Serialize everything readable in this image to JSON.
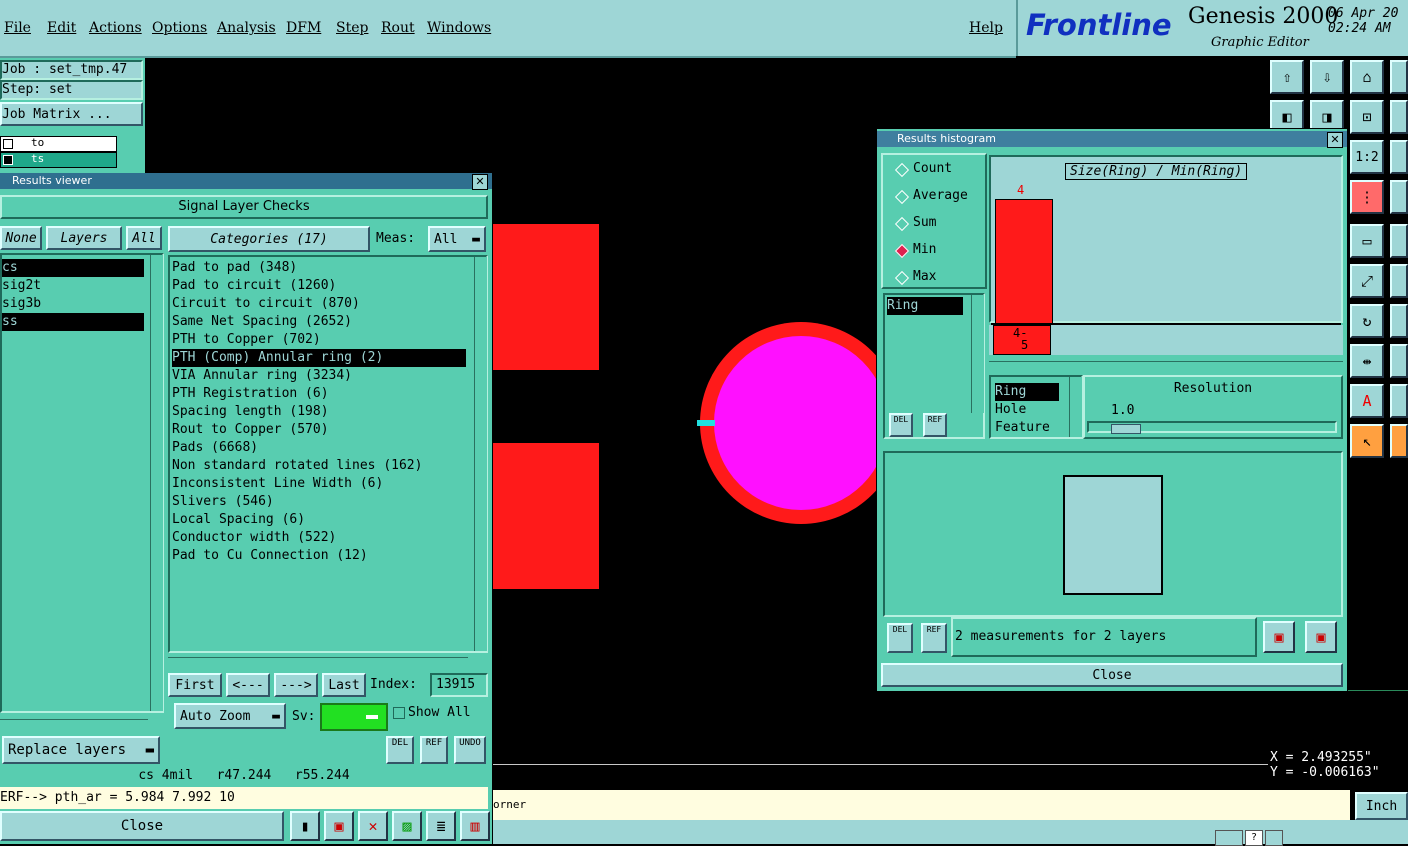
{
  "menu": {
    "file": "File",
    "edit": "Edit",
    "actions": "Actions",
    "options": "Options",
    "analysis": "Analysis",
    "dfm": "DFM",
    "step": "Step",
    "rout": "Rout",
    "windows": "Windows",
    "help": "Help"
  },
  "brand": {
    "logo": "Frontline",
    "title": "Genesis 2000",
    "subtitle": "Graphic Editor",
    "date": "06 Apr 20",
    "time": "02:24 AM"
  },
  "job": {
    "job": "Job : set_tmp.47",
    "step": "Step: set",
    "matrix": "Job Matrix ..."
  },
  "layers_small": [
    "to",
    "ts"
  ],
  "results_viewer": {
    "title": "Results viewer",
    "header": "Signal Layer Checks",
    "none": "None",
    "layers": "Layers",
    "all": "All",
    "categories_label": "Categories (17)",
    "meas_label": "Meas:",
    "meas_value": "All",
    "layer_list": [
      "cs",
      "sig2t",
      "sig3b",
      "ss"
    ],
    "categories": [
      "Pad to pad (348)",
      "Pad to circuit (1260)",
      "Circuit to circuit (870)",
      "Same Net Spacing (2652)",
      "PTH to Copper (702)",
      "PTH (Comp) Annular ring (2)",
      "VIA Annular ring (3234)",
      "PTH Registration (6)",
      "Spacing length (198)",
      "Rout to Copper (570)",
      "Pads (6668)",
      "Non standard rotated lines (162)",
      "Inconsistent Line Width (6)",
      "Slivers (546)",
      "Local Spacing (6)",
      "Conductor width (522)",
      "Pad to Cu Connection (12)"
    ],
    "first": "First",
    "prev": "<---",
    "next": "--->",
    "last": "Last",
    "index_label": "Index:",
    "index_value": "13915",
    "auto_zoom": "Auto Zoom",
    "sv": "Sv:",
    "show_all": "Show All",
    "replace_layers": "Replace layers",
    "del": "DEL",
    "ref": "REF",
    "undo": "UNDO",
    "status": "cs 4mil   r47.244   r55.244",
    "erf": "ERF--> pth_ar = 5.984 7.992 10",
    "close": "Close"
  },
  "histogram": {
    "title": "Results histogram",
    "options": [
      "Count",
      "Average",
      "Sum",
      "Min",
      "Max"
    ],
    "selected_option": "Min",
    "chart_title": "Size(Ring) / Min(Ring)",
    "bar_label": "4",
    "range_label_top": "4-",
    "range_label_bottom": "5",
    "attr_list": [
      "Ring"
    ],
    "attr_list2": [
      "Ring",
      "Hole",
      "Feature"
    ],
    "resolution_label": "Resolution",
    "resolution_value": "1.0",
    "del": "DEL",
    "ref": "REF",
    "measurements": "2 measurements for 2 layers",
    "close": "Close"
  },
  "coords": {
    "x": "X = 2.493255\"",
    "y": "Y = -0.006163\""
  },
  "unit": "Inch",
  "bottom_msg": "orner",
  "colors": {
    "copper": "#ff1a1a",
    "pad": "#ff10ff",
    "panel": "#58cdb0",
    "light": "#9ed6d6"
  }
}
